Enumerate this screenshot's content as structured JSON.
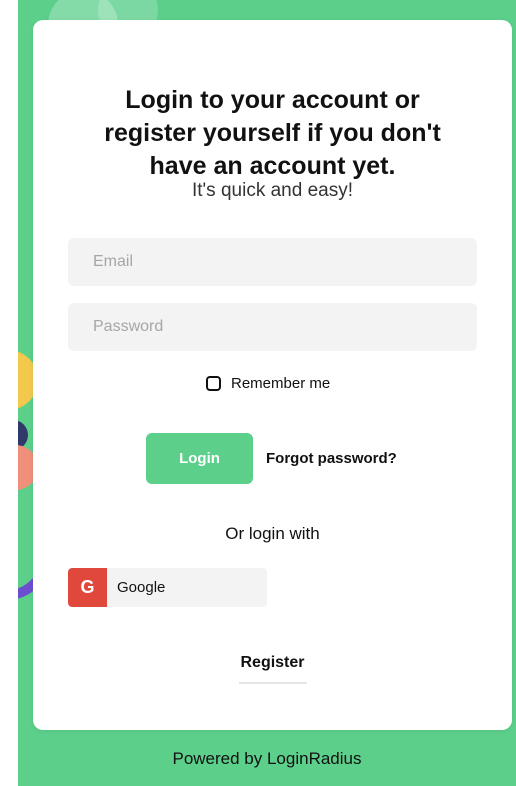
{
  "header": {
    "title": "Login to your account or\nregister yourself if you don't\nhave an account yet.",
    "subtitle": "It's quick and easy!"
  },
  "form": {
    "email_placeholder": "Email",
    "password_placeholder": "Password",
    "remember_label": "Remember me",
    "remember_checked": false
  },
  "actions": {
    "login_label": "Login",
    "forgot_label": "Forgot password?"
  },
  "social": {
    "or_label": "Or login with",
    "google_letter": "G",
    "google_label": "Google"
  },
  "footer": {
    "register_label": "Register",
    "powered_by": "Powered by LoginRadius"
  },
  "colors": {
    "brand_green": "#5ccf8b",
    "google_red": "#e0483b"
  }
}
